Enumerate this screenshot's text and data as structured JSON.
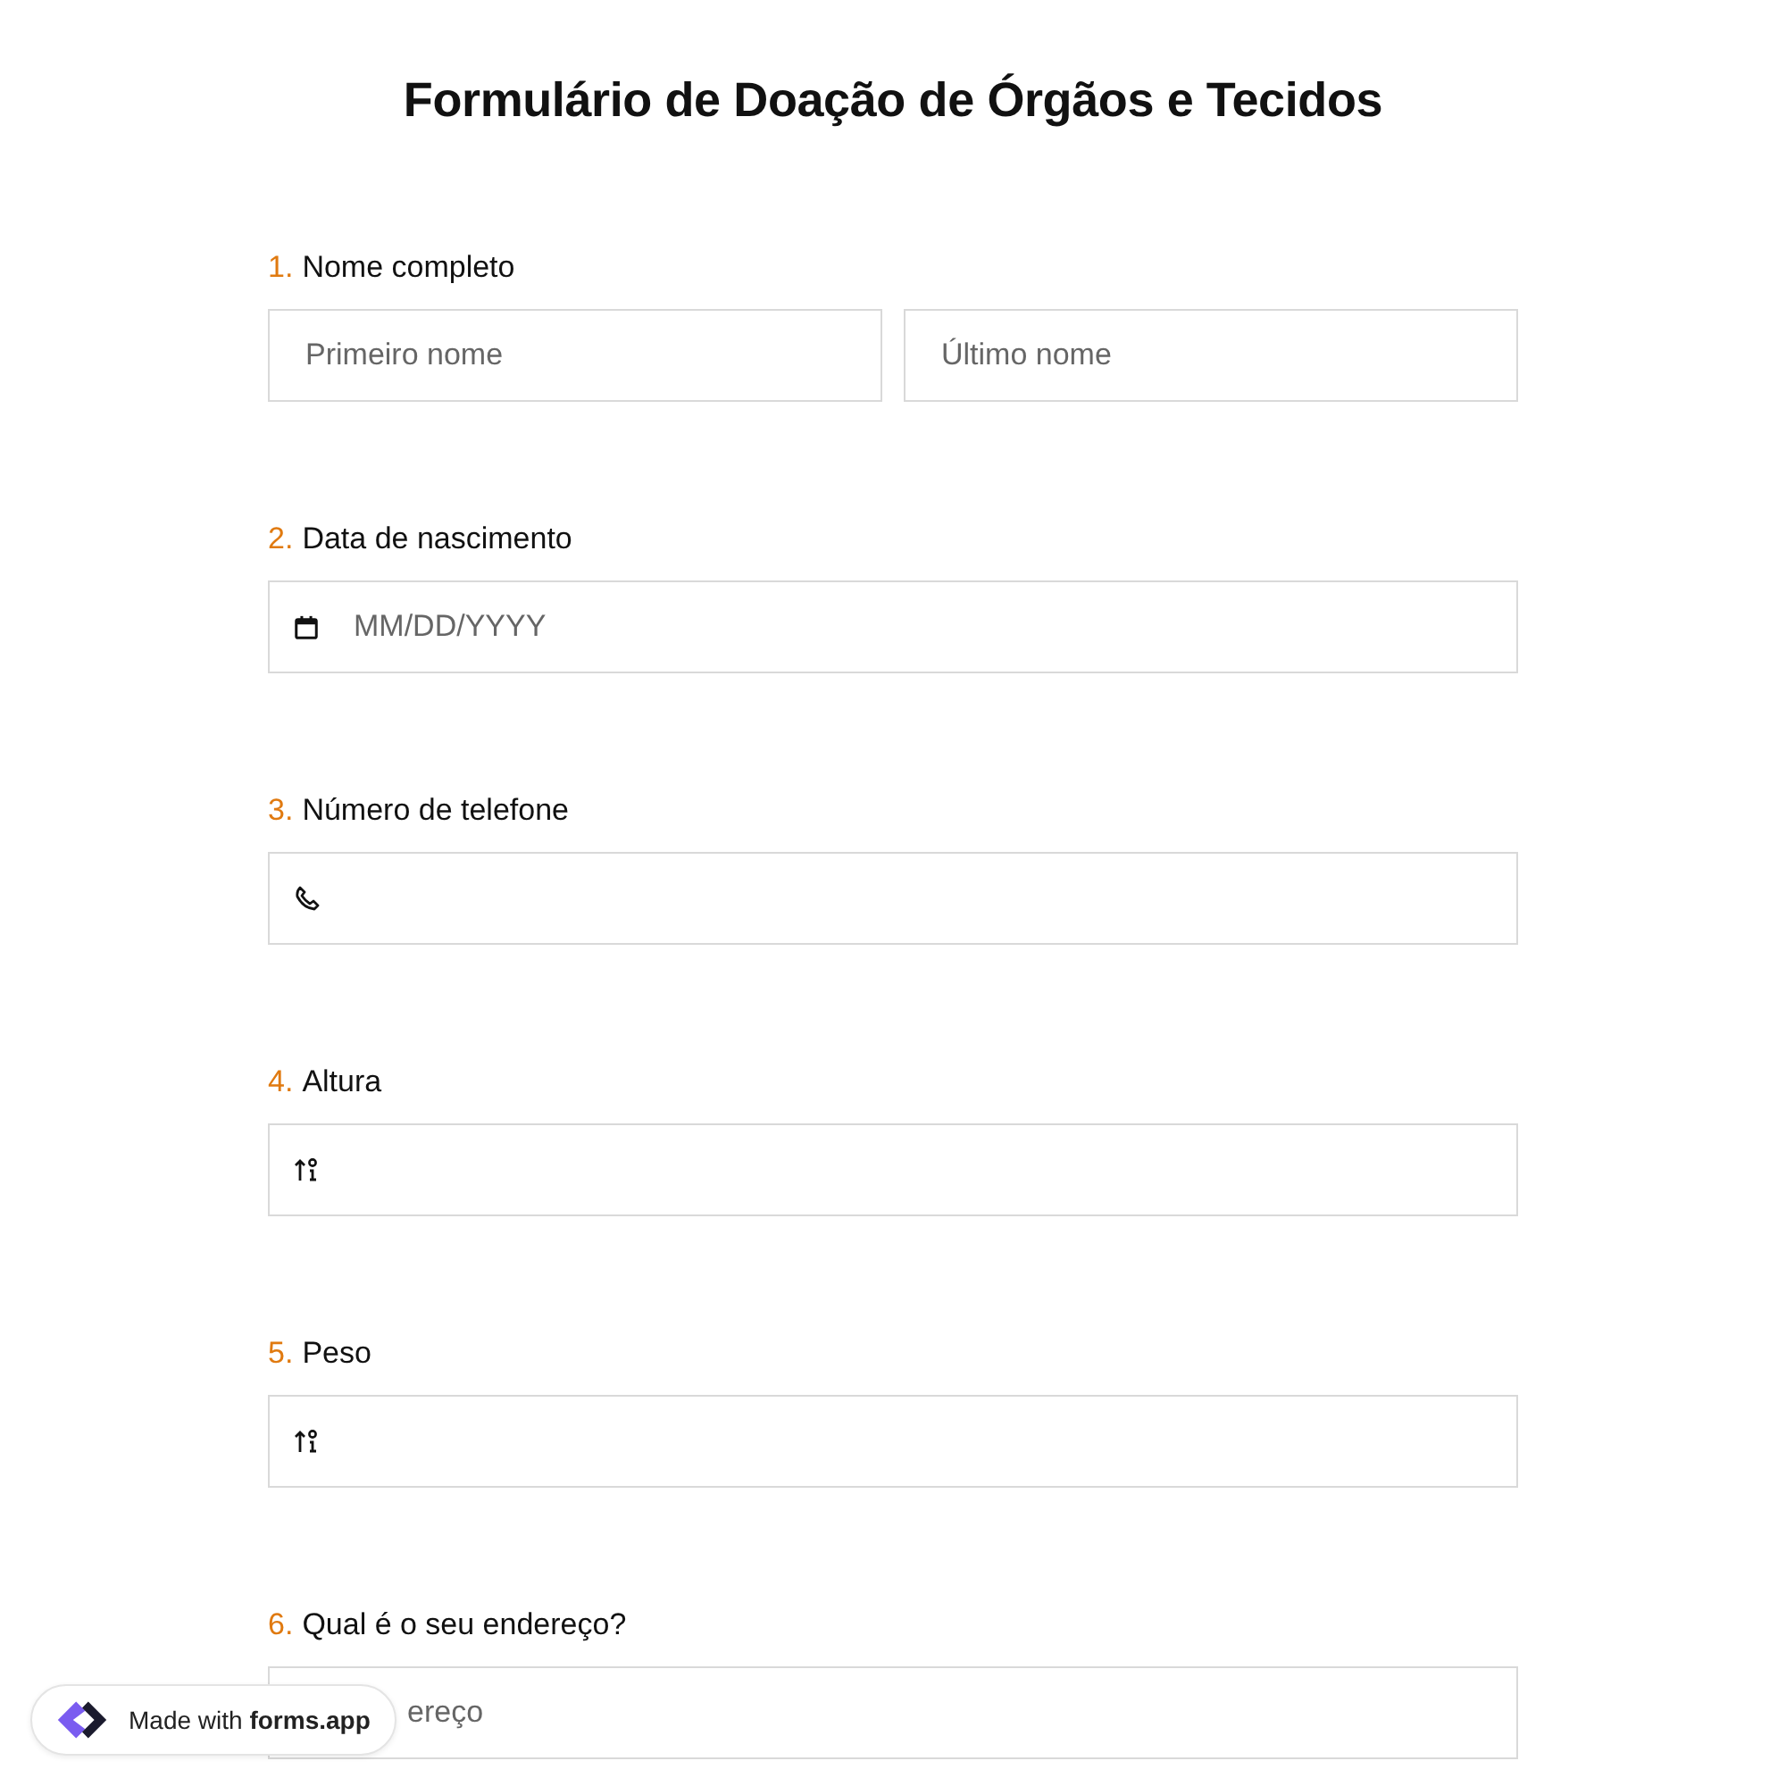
{
  "title": "Formulário de Doação de Órgãos e Tecidos",
  "questions": [
    {
      "number": "1.",
      "label": "Nome completo",
      "kind": "name",
      "fields": [
        {
          "placeholder": "Primeiro nome"
        },
        {
          "placeholder": "Último nome"
        }
      ]
    },
    {
      "number": "2.",
      "label": "Data de nascimento",
      "kind": "date",
      "fields": [
        {
          "placeholder": "MM/DD/YYYY"
        }
      ]
    },
    {
      "number": "3.",
      "label": "Número de telefone",
      "kind": "phone"
    },
    {
      "number": "4.",
      "label": "Altura",
      "kind": "number"
    },
    {
      "number": "5.",
      "label": "Peso",
      "kind": "number"
    },
    {
      "number": "6.",
      "label": "Qual é o seu endereço?",
      "kind": "text",
      "fields": [
        {
          "placeholder": "ereço"
        }
      ]
    }
  ],
  "badge": {
    "prefix": "Made with",
    "brand": "forms.app"
  }
}
